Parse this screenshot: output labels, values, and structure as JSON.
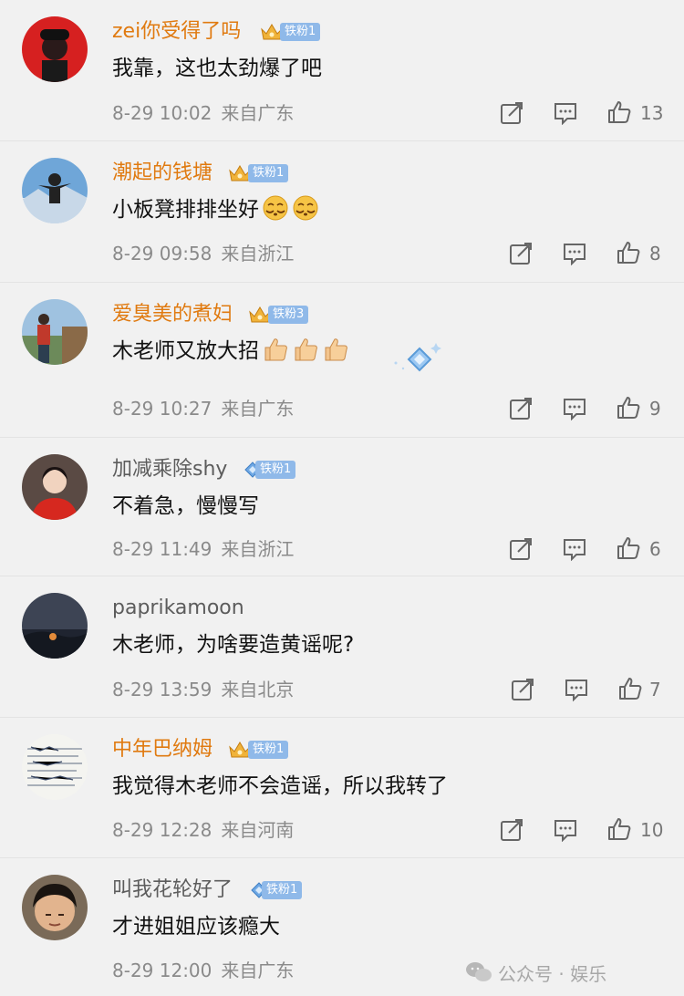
{
  "comments": [
    {
      "user": "zei你受得了吗",
      "level": "铁粉1",
      "badge": "crown",
      "text": "我靠，这也太劲爆了吧",
      "time": "8-29 10:02",
      "location": "来自广东",
      "likes": "13"
    },
    {
      "user": "潮起的钱塘",
      "level": "铁粉1",
      "badge": "crown",
      "text": "小板凳排排坐好",
      "emojis": [
        "sneaky-face",
        "sneaky-face"
      ],
      "time": "8-29 09:58",
      "location": "来自浙江",
      "likes": "8"
    },
    {
      "user": "爱臭美的煮妇",
      "level": "铁粉3",
      "badge": "crown",
      "text": "木老师又放大招",
      "emojis": [
        "thumbs-up",
        "thumbs-up",
        "thumbs-up"
      ],
      "time": "8-29 10:27",
      "location": "来自广东",
      "likes": "9"
    },
    {
      "user": "加减乘除shy",
      "level": "铁粉1",
      "badge": "diamond",
      "text": "不着急，慢慢写",
      "time": "8-29 11:49",
      "location": "来自浙江",
      "likes": "6"
    },
    {
      "user": "paprikamoon",
      "level": "",
      "badge": "none",
      "text": "木老师，为啥要造黄谣呢?",
      "time": "8-29 13:59",
      "location": "来自北京",
      "likes": "7"
    },
    {
      "user": "中年巴纳姆",
      "level": "铁粉1",
      "badge": "crown",
      "text": "我觉得木老师不会造谣，所以我转了",
      "time": "8-29 12:28",
      "location": "来自河南",
      "likes": "10"
    },
    {
      "user": "叫我花轮好了",
      "level": "铁粉1",
      "badge": "diamond",
      "text": "才进姐姐应该瘾大",
      "time": "8-29 12:00",
      "location": "来自广东",
      "likes": ""
    }
  ],
  "watermark": {
    "text": "公众号 · 娱乐"
  },
  "colors": {
    "gold_name": "#e07a10",
    "gray_name": "#5c5c5c",
    "fan_tag": "#8fb9e9",
    "meta": "#8a8a8a",
    "background": "#f1f1f1"
  }
}
